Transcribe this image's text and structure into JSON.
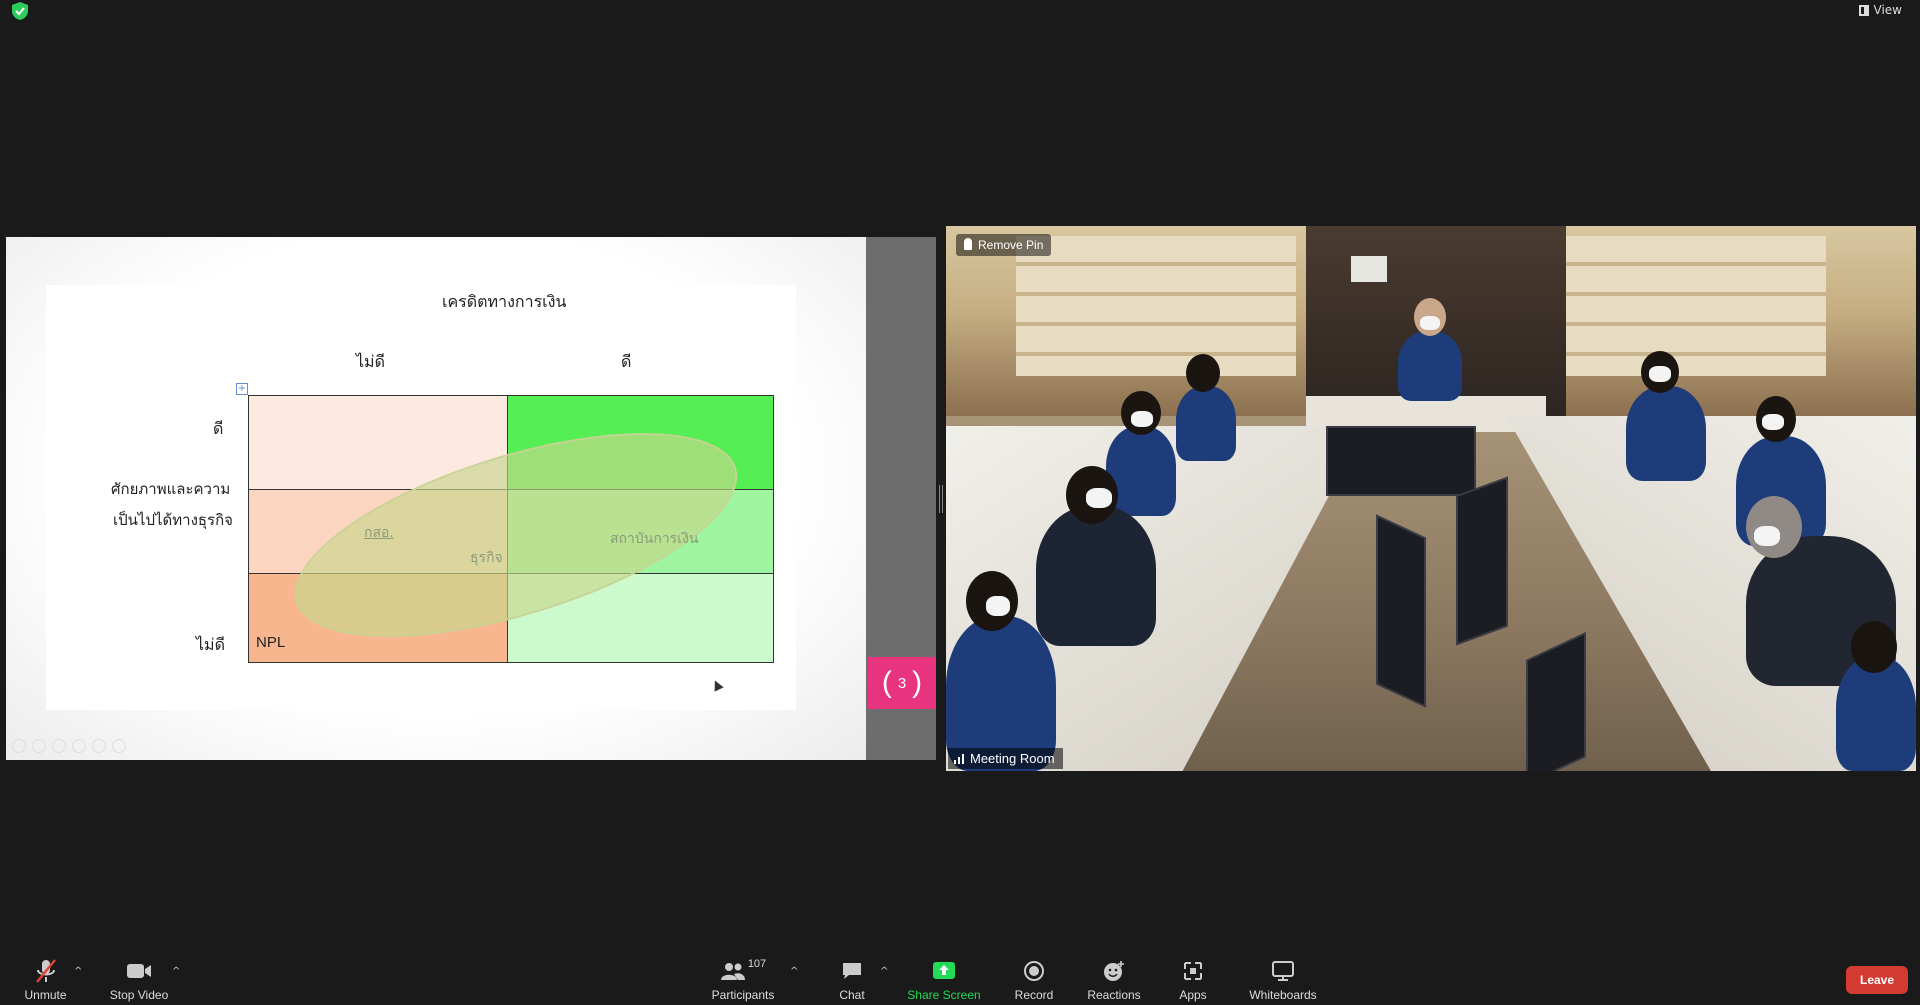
{
  "top": {
    "view_label": "View"
  },
  "slide": {
    "title": "เครดิตทางการเงิน",
    "col_bad": "ไม่ดี",
    "col_good": "ดี",
    "row_good": "ดี",
    "row_label_line1": "ศักยภาพและความ",
    "row_label_line2": "เป็นไปได้ทางธุรกิจ",
    "row_bad": "ไม่ดี",
    "npl": "NPL",
    "label_gso": "กสอ.",
    "label_business": "ธุรกิจ",
    "label_institution": "สถาบันการเงิน",
    "page_number": "3",
    "colors": {
      "cell_tl": "#fde9df",
      "cell_ml": "#fbd5bf",
      "cell_bl": "#f7b68e",
      "cell_tr": "#55ee55",
      "cell_mr": "#9ff49f",
      "cell_br": "#ccfacc",
      "page_badge": "#e8337f"
    }
  },
  "video": {
    "remove_pin": "Remove Pin",
    "room_name": "Meeting Room"
  },
  "toolbar": {
    "unmute": "Unmute",
    "stop_video": "Stop Video",
    "participants": "Participants",
    "participants_count": "107",
    "chat": "Chat",
    "share_screen": "Share Screen",
    "record": "Record",
    "reactions": "Reactions",
    "apps": "Apps",
    "whiteboards": "Whiteboards",
    "leave": "Leave",
    "accent_green": "#23d959",
    "leave_color": "#d33a32"
  }
}
